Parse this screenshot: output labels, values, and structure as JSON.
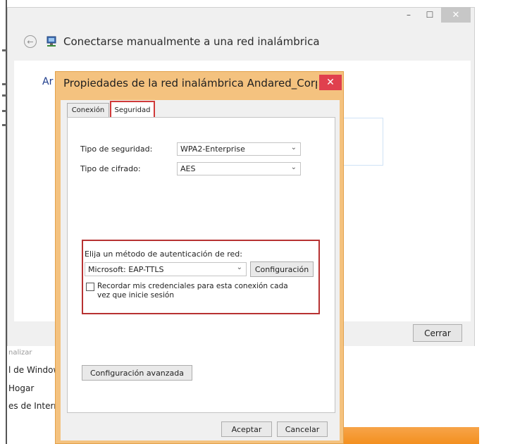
{
  "background_window": {
    "title": "Conectarse manualmente a una red inalámbrica",
    "body_partial_heading": "Ar",
    "close_button_label": "Cerrar",
    "nav_items_partial": [
      "nalizar",
      "l de Window",
      "Hogar",
      "es de Interne"
    ],
    "window_controls": {
      "minimize": "–",
      "maximize": "☐",
      "close": "✕"
    },
    "back_icon": "back-arrow-icon",
    "title_icon": "network-icon"
  },
  "dialog": {
    "title": "Propiedades de la red inalámbrica Andared_Corp...",
    "close_glyph": "✕",
    "tabs": [
      {
        "label": "Conexión",
        "active": false
      },
      {
        "label": "Seguridad",
        "active": true
      }
    ],
    "security_type": {
      "label": "Tipo de seguridad:",
      "value": "WPA2-Enterprise"
    },
    "encryption_type": {
      "label": "Tipo de cifrado:",
      "value": "AES"
    },
    "auth_method": {
      "label": "Elija un método de autenticación de red:",
      "value": "Microsoft: EAP-TTLS",
      "settings_button": "Configuración"
    },
    "remember_credentials": {
      "checked": false,
      "label": "Recordar mis credenciales para esta conexión cada vez que inicie sesión"
    },
    "advanced_settings_button": "Configuración avanzada",
    "accept_button": "Aceptar",
    "cancel_button": "Cancelar"
  },
  "colors": {
    "dialog_frame": "#f4c27f",
    "dialog_close": "#e0404e",
    "highlight_red": "#b73232",
    "taskbar_orange": "#f39020"
  }
}
